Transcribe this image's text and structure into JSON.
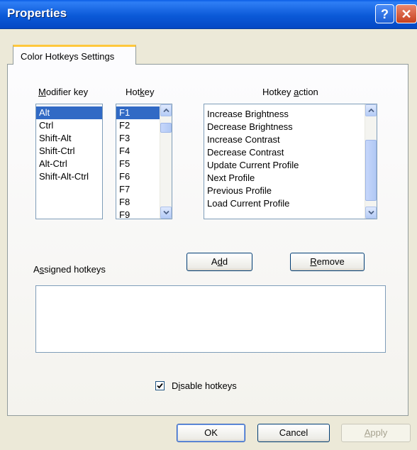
{
  "window": {
    "title": "Properties",
    "help_glyph": "?",
    "close_glyph": "✕"
  },
  "tab": {
    "label": "Color Hotkeys Settings"
  },
  "modifier": {
    "label_pre": "",
    "label_u": "M",
    "label_post": "odifier key",
    "items": [
      "Alt",
      "Ctrl",
      "Shift-Alt",
      "Shift-Ctrl",
      "Alt-Ctrl",
      "Shift-Alt-Ctrl"
    ],
    "selected_index": 0
  },
  "hotkey": {
    "label_pre": "Hot",
    "label_u": "k",
    "label_post": "ey",
    "items": [
      "F1",
      "F2",
      "F3",
      "F4",
      "F5",
      "F6",
      "F7",
      "F8",
      "F9"
    ],
    "selected_index": 0
  },
  "action": {
    "label_pre": "Hotkey ",
    "label_u": "a",
    "label_post": "ction",
    "items": [
      "Increase Brightness",
      "Decrease Brightness",
      "Increase Contrast",
      "Decrease Contrast",
      "Update Current Profile",
      "Next Profile",
      "Previous Profile",
      "Load Current Profile"
    ]
  },
  "assigned": {
    "label_pre": "A",
    "label_u": "s",
    "label_post": "signed hotkeys"
  },
  "buttons": {
    "add_pre": "A",
    "add_u": "d",
    "add_post": "d",
    "remove_pre": "",
    "remove_u": "R",
    "remove_post": "emove",
    "ok": "OK",
    "cancel": "Cancel",
    "apply_pre": "",
    "apply_u": "A",
    "apply_post": "pply"
  },
  "disable": {
    "checked": true,
    "label_pre": "D",
    "label_u": "i",
    "label_post": "sable hotkeys"
  }
}
